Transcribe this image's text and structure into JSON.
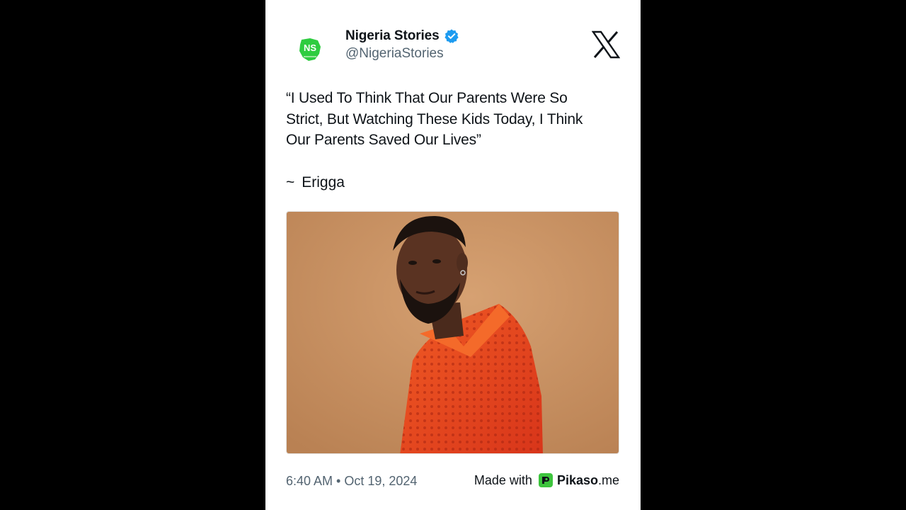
{
  "tweet": {
    "author": {
      "name": "Nigeria Stories",
      "handle": "@NigeriaStories",
      "avatar_icon": "nigeria-stories-logo-icon",
      "verified_icon": "verified-badge-icon",
      "verified_color": "#1d9bf0",
      "logo_color": "#2ecc40"
    },
    "platform_icon": "x-logo-icon",
    "text_lines": [
      "“I Used To Think That Our Parents Were So",
      "Strict, But Watching These Kids Today, I Think",
      "Our Parents Saved Our Lives”"
    ],
    "attribution": {
      "tilde": "~",
      "name": "Erigga"
    },
    "media": {
      "type": "photo",
      "background_color": "#c8915e",
      "shirt_color": "#e8401c"
    },
    "timestamp": "6:40 AM • Oct 19, 2024"
  },
  "footer": {
    "made_with": "Made with",
    "brand_name": "Pikaso",
    "brand_tld": ".me",
    "brand_icon": "pikaso-logo-icon",
    "brand_color": "#3dc43d"
  }
}
